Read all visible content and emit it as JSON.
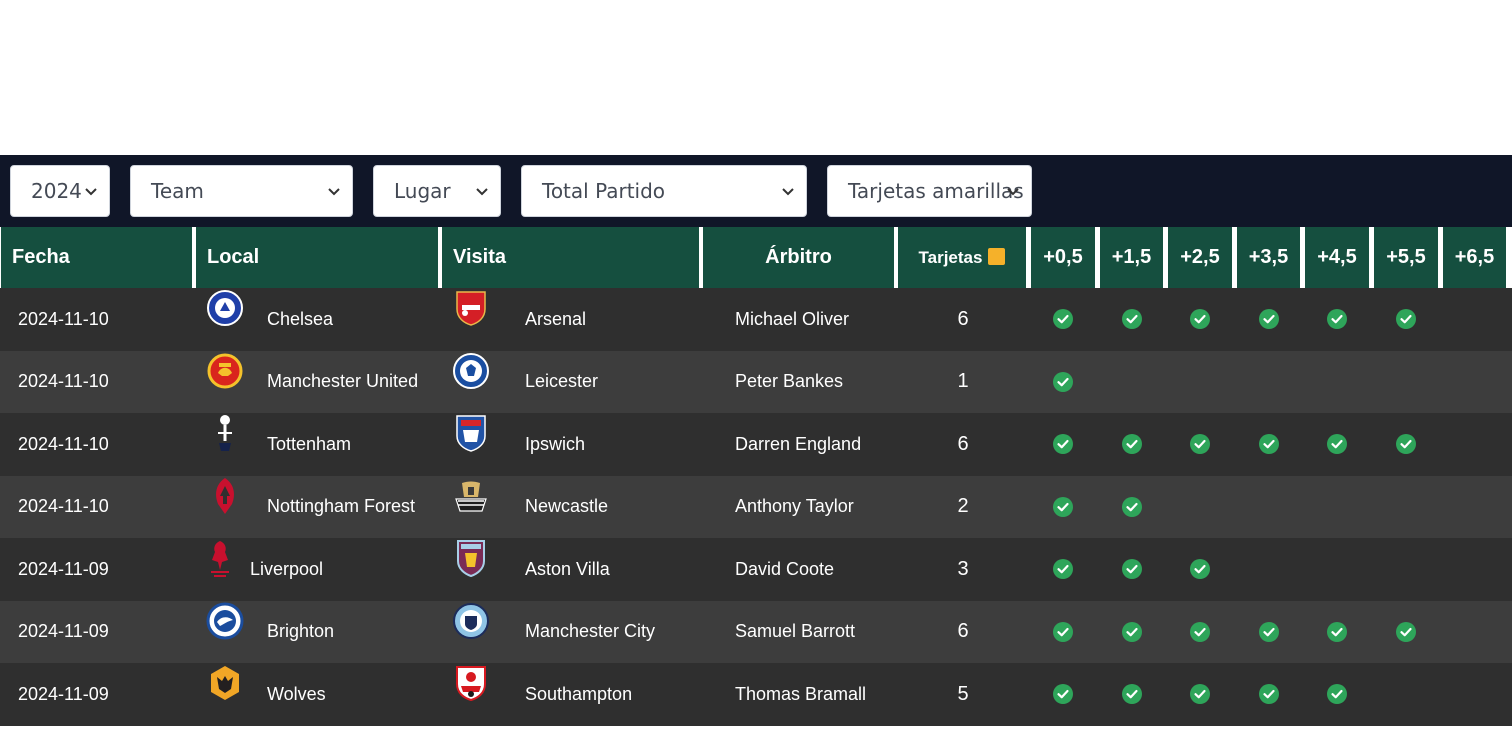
{
  "filters": {
    "year": "2024",
    "team": "Team",
    "place": "Lugar",
    "scope": "Total Partido",
    "stat": "Tarjetas amarillas"
  },
  "headers": {
    "fecha": "Fecha",
    "local": "Local",
    "visita": "Visita",
    "arbitro": "Árbitro",
    "tarjetas": "Tarjetas",
    "thresholds": [
      "+0,5",
      "+1,5",
      "+2,5",
      "+3,5",
      "+4,5",
      "+5,5",
      "+6,5"
    ]
  },
  "colors": {
    "header_green": "#154f3f",
    "check_green": "#2ea55a",
    "card_yellow": "#f5b12a",
    "topbar": "#101628"
  },
  "rows": [
    {
      "date": "2024-11-10",
      "home": "Chelsea",
      "home_icon": "chelsea-crest-icon",
      "away": "Arsenal",
      "away_icon": "arsenal-crest-icon",
      "referee": "Michael Oliver",
      "cards": "6",
      "checks": [
        true,
        true,
        true,
        true,
        true,
        true,
        false
      ]
    },
    {
      "date": "2024-11-10",
      "home": "Manchester United",
      "home_icon": "manchester-united-crest-icon",
      "away": "Leicester",
      "away_icon": "leicester-crest-icon",
      "referee": "Peter Bankes",
      "cards": "1",
      "checks": [
        true,
        false,
        false,
        false,
        false,
        false,
        false
      ]
    },
    {
      "date": "2024-11-10",
      "home": "Tottenham",
      "home_icon": "tottenham-crest-icon",
      "away": "Ipswich",
      "away_icon": "ipswich-crest-icon",
      "referee": "Darren England",
      "cards": "6",
      "checks": [
        true,
        true,
        true,
        true,
        true,
        true,
        false
      ]
    },
    {
      "date": "2024-11-10",
      "home": "Nottingham Forest",
      "home_icon": "nottingham-forest-crest-icon",
      "away": "Newcastle",
      "away_icon": "newcastle-crest-icon",
      "referee": "Anthony Taylor",
      "cards": "2",
      "checks": [
        true,
        true,
        false,
        false,
        false,
        false,
        false
      ]
    },
    {
      "date": "2024-11-09",
      "home": "Liverpool",
      "home_icon": "liverpool-crest-icon",
      "away": "Aston Villa",
      "away_icon": "aston-villa-crest-icon",
      "referee": "David Coote",
      "cards": "3",
      "checks": [
        true,
        true,
        true,
        false,
        false,
        false,
        false
      ]
    },
    {
      "date": "2024-11-09",
      "home": "Brighton",
      "home_icon": "brighton-crest-icon",
      "away": "Manchester City",
      "away_icon": "manchester-city-crest-icon",
      "referee": "Samuel Barrott",
      "cards": "6",
      "checks": [
        true,
        true,
        true,
        true,
        true,
        true,
        false
      ]
    },
    {
      "date": "2024-11-09",
      "home": "Wolves",
      "home_icon": "wolves-crest-icon",
      "away": "Southampton",
      "away_icon": "southampton-crest-icon",
      "referee": "Thomas Bramall",
      "cards": "5",
      "checks": [
        true,
        true,
        true,
        true,
        true,
        false,
        false
      ]
    }
  ]
}
